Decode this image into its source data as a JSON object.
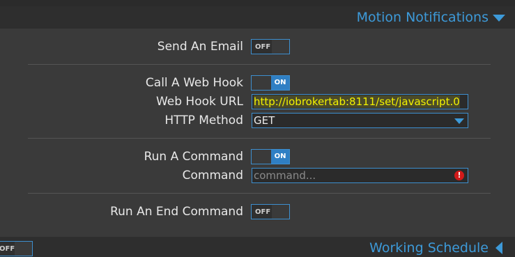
{
  "sections": {
    "motion_notifications": {
      "title": "Motion Notifications",
      "expanded": true
    },
    "working_schedule": {
      "title": "Working Schedule",
      "expanded": false,
      "toggle_label": "OFF"
    }
  },
  "email": {
    "label": "Send An Email",
    "toggle_label": "OFF"
  },
  "webhook": {
    "label": "Call A Web Hook",
    "toggle_label": "ON",
    "url_label": "Web Hook URL",
    "url_value": "http://iobrokertab:8111/set/javascript.0",
    "method_label": "HTTP Method",
    "method_value": "GET"
  },
  "command": {
    "label": "Run A Command",
    "toggle_label": "ON",
    "field_label": "Command",
    "placeholder": "command..."
  },
  "end_command": {
    "label": "Run An End Command",
    "toggle_label": "OFF"
  },
  "colors": {
    "accent": "#3d9ad9",
    "on": "#2f7fc4",
    "url_text": "#f2f200",
    "error": "#d11a1a"
  },
  "icons": {
    "expand": "triangle-down-icon",
    "collapse": "triangle-left-icon",
    "error": "error-icon"
  }
}
